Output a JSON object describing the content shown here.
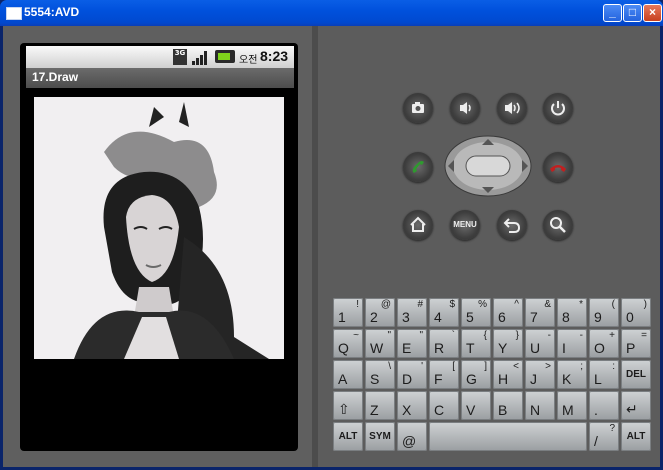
{
  "window": {
    "title": "5554:AVD"
  },
  "status_bar": {
    "network": "3G",
    "ampm": "오전",
    "time": "8:23"
  },
  "app": {
    "title": "17.Draw"
  },
  "hardware_buttons": [
    "camera-icon",
    "volume-down-icon",
    "volume-up-icon",
    "power-icon",
    "call-icon",
    "end-call-icon",
    "home-icon",
    "menu-button",
    "back-icon",
    "search-icon"
  ],
  "menu_label": "MENU",
  "keyboard": {
    "row1": [
      [
        "1",
        "!"
      ],
      [
        "2",
        "@"
      ],
      [
        "3",
        "#"
      ],
      [
        "4",
        "$"
      ],
      [
        "5",
        "%"
      ],
      [
        "6",
        "^"
      ],
      [
        "7",
        "&"
      ],
      [
        "8",
        "*"
      ],
      [
        "9",
        "("
      ],
      [
        "0",
        ")"
      ]
    ],
    "row2": [
      [
        "Q",
        "~"
      ],
      [
        "W",
        "\""
      ],
      [
        "E",
        "\""
      ],
      [
        "R",
        "`"
      ],
      [
        "T",
        "{"
      ],
      [
        "Y",
        "}"
      ],
      [
        "U",
        "-"
      ],
      [
        "I",
        "-"
      ],
      [
        "O",
        "+"
      ],
      [
        "P",
        "="
      ]
    ],
    "row3": [
      [
        "A",
        ""
      ],
      [
        "S",
        "\\"
      ],
      [
        "D",
        "'"
      ],
      [
        "F",
        "["
      ],
      [
        "G",
        "]"
      ],
      [
        "H",
        "<"
      ],
      [
        "J",
        ">"
      ],
      [
        "K",
        ";"
      ],
      [
        "L",
        ":"
      ],
      [
        "DEL",
        ""
      ]
    ],
    "row4": [
      [
        "⇧",
        ""
      ],
      [
        "Z",
        ""
      ],
      [
        "X",
        ""
      ],
      [
        "C",
        ""
      ],
      [
        "V",
        ""
      ],
      [
        "B",
        ""
      ],
      [
        "N",
        ""
      ],
      [
        "M",
        ""
      ],
      [
        ".",
        ""
      ],
      [
        "↵",
        ""
      ]
    ],
    "row5": {
      "alt": "ALT",
      "sym": "SYM",
      "at": "@",
      "space": "",
      "slash": "/",
      "question": "?",
      "comma": ",",
      "alt2": "ALT"
    }
  },
  "colors": {
    "call": "#2f9a2f",
    "end_call": "#c02020",
    "battery": "#7fd31b"
  }
}
